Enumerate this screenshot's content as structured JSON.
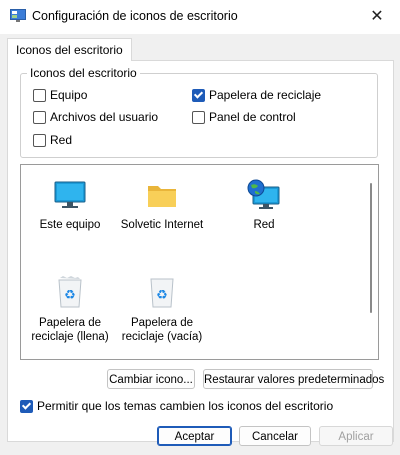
{
  "window": {
    "title": "Configuración de iconos de escritorio",
    "close_glyph": "✕"
  },
  "tab": {
    "label": "Iconos del escritorio"
  },
  "group": {
    "legend": "Iconos del escritorio",
    "checkboxes": [
      {
        "label": "Equipo",
        "checked": false
      },
      {
        "label": "Papelera de reciclaje",
        "checked": true
      },
      {
        "label": "Archivos del usuario",
        "checked": false
      },
      {
        "label": "Panel de control",
        "checked": false
      },
      {
        "label": "Red",
        "checked": false
      }
    ]
  },
  "icons": [
    {
      "label": "Este equipo",
      "icon": "monitor-icon"
    },
    {
      "label": "Solvetic Internet",
      "icon": "folder-icon"
    },
    {
      "label": "Red",
      "icon": "network-globe-icon"
    },
    {
      "label": "Papelera de reciclaje (llena)",
      "icon": "recycle-bin-full-icon"
    },
    {
      "label": "Papelera de reciclaje (vacía)",
      "icon": "recycle-bin-empty-icon"
    }
  ],
  "buttons": {
    "change_icon": "Cambiar icono...",
    "restore_defaults": "Restaurar valores predeterminados",
    "ok": "Aceptar",
    "cancel": "Cancelar",
    "apply": "Aplicar"
  },
  "themes_checkbox": {
    "label": "Permitir que los temas cambien los iconos del escritorio",
    "checked": true
  },
  "colors": {
    "accent": "#1e5bb8"
  }
}
